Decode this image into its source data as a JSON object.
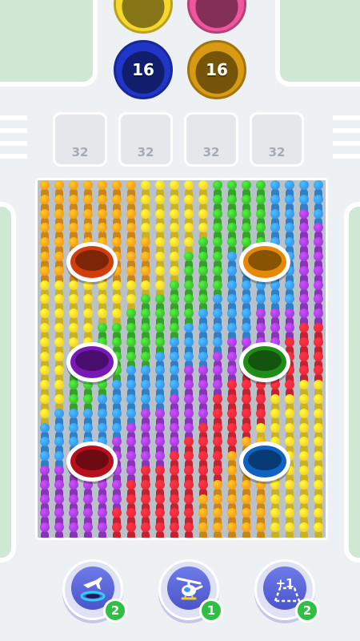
{
  "colors": {
    "orange": "#f6a21c",
    "yellow": "#f6d72b",
    "green": "#3fc531",
    "blue": "#3a9aee",
    "purple": "#a83ee0",
    "red": "#ee2a3a",
    "pink": "#f0569f",
    "navy": "#1f36c8",
    "gold": "#d79a12",
    "grass": "#cfe8d4",
    "badge": "#2fbf44"
  },
  "top_buckets": [
    {
      "name": "yellow-bucket",
      "color": "yellow",
      "count": ""
    },
    {
      "name": "pink-bucket",
      "color": "pink",
      "count": ""
    },
    {
      "name": "navy-bucket",
      "color": "navy",
      "count": "16"
    },
    {
      "name": "gold-bucket",
      "color": "gold",
      "count": "16"
    }
  ],
  "slots": [
    {
      "count": "32"
    },
    {
      "count": "32"
    },
    {
      "count": "32"
    },
    {
      "count": "32"
    }
  ],
  "board": {
    "cols": 20,
    "rows": 25,
    "legend": {
      "O": "orange",
      "Y": "yellow",
      "G": "green",
      "B": "blue",
      "P": "purple",
      "R": "red"
    },
    "grid": [
      "OOOOOOOYYYYYGGGGBBBB",
      "OOOOOOOYYYYYGGGGBBBB",
      "OOOOOOOYYYYYGGGGBBPB",
      "OOOOOOOYYYYYGGGGBBPP",
      "OOOOOOOOYYYGGGGGBBPP",
      "OOOOOOOOYYGGGBBBBBPP",
      "OOOOOOOOYYGGGBBBBBPP",
      "YYYYYYYYYGGGGBBBBBPP",
      "YYYYYYYGGGGGBBBBBBPP",
      "YYYYYYGGGGGBBBBPPPPP",
      "YYYYGGGGGGBBBBBPPPRR",
      "YYYYGGGGGBBBBPPPPRRR",
      "YYYYGGGGBBBBPPPPRRRR",
      "YYGGGGBBBBPPPPRRRRRR",
      "YYGGGBBBBBPPPRRRRRYY",
      "YYGGBBBBBPPPRRRRYYYY",
      "YBBBBBBPPPPPRRRRYYYY",
      "BBBBBBPPPPPRRRRYYYYY",
      "BBBBBPPPPPRRRROOYYYY",
      "BBBPPPPPPRRRROOOYYYY",
      "PPPPPPPRRRRRROOOYYYY",
      "PPPPPPRRRRRROOOOYYYY",
      "PPPPPPRRRRROOOOOYYYY",
      "PPPPPRRRRRROOOOOYYYY",
      "PPPPPRRRRRROOOOOYYYY"
    ],
    "holes": [
      {
        "name": "orange-hole",
        "color": "orange",
        "rim": "#d23d0c",
        "cell": [
          2,
          5
        ]
      },
      {
        "name": "yellow-orange-hole",
        "color": "orange",
        "rim": "#e58a07",
        "cell": [
          14,
          5
        ]
      },
      {
        "name": "purple-hole",
        "color": "purple",
        "rim": "#7a18b5",
        "cell": [
          2,
          12
        ]
      },
      {
        "name": "green-hole",
        "color": "green",
        "rim": "#1f8e18",
        "cell": [
          14,
          12
        ]
      },
      {
        "name": "red-hole",
        "color": "red",
        "rim": "#b7101c",
        "cell": [
          2,
          19
        ]
      },
      {
        "name": "blue-hole",
        "color": "blue",
        "rim": "#0e63c2",
        "cell": [
          14,
          19
        ]
      }
    ]
  },
  "powerups": [
    {
      "name": "magnet-powerup",
      "icon": "plane-hole-icon",
      "count": "2"
    },
    {
      "name": "helicopter-powerup",
      "icon": "helicopter-icon",
      "count": "1"
    },
    {
      "name": "add-slot-powerup",
      "icon": "plus-one-slot-icon",
      "label": "+1",
      "count": "2"
    }
  ]
}
